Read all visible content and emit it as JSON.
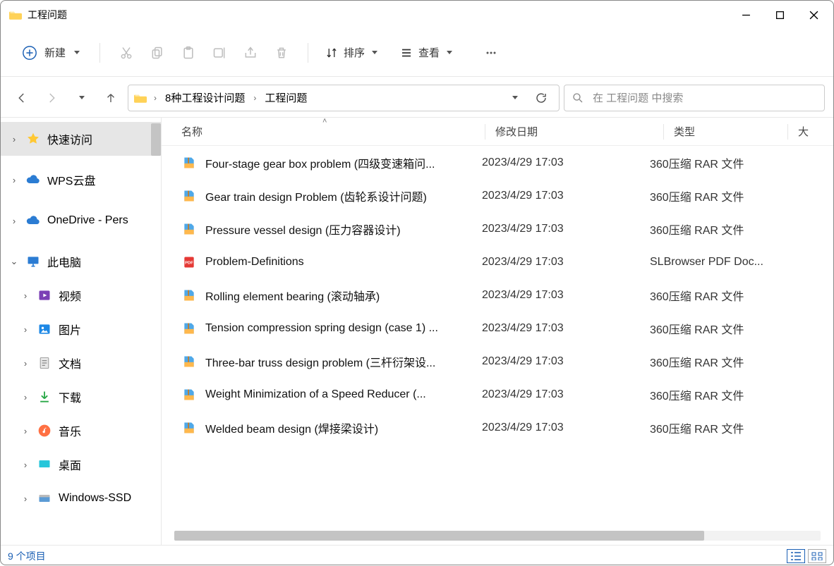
{
  "window": {
    "title": "工程问题"
  },
  "toolbar": {
    "new_label": "新建",
    "sort_label": "排序",
    "view_label": "查看"
  },
  "breadcrumb": {
    "items": [
      "8种工程设计问题",
      "工程问题"
    ]
  },
  "search": {
    "placeholder": "在 工程问题 中搜索"
  },
  "sidebar": {
    "quick": {
      "label": "快速访问",
      "selected": true
    },
    "wps": {
      "label": "WPS云盘"
    },
    "onedrive": {
      "label": "OneDrive - Pers"
    },
    "thispc": {
      "label": "此电脑",
      "expanded": true
    },
    "thispc_items": [
      {
        "label": "视频"
      },
      {
        "label": "图片"
      },
      {
        "label": "文档"
      },
      {
        "label": "下载"
      },
      {
        "label": "音乐"
      },
      {
        "label": "桌面"
      },
      {
        "label": "Windows-SSD"
      }
    ]
  },
  "columns": {
    "name": "名称",
    "date": "修改日期",
    "type": "类型",
    "size": "大"
  },
  "files": [
    {
      "name": "Four-stage gear box problem (四级变速箱问...",
      "date": "2023/4/29 17:03",
      "type": "360压缩 RAR 文件",
      "icon": "rar"
    },
    {
      "name": "Gear train design Problem (齿轮系设计问题)",
      "date": "2023/4/29 17:03",
      "type": "360压缩 RAR 文件",
      "icon": "rar"
    },
    {
      "name": "Pressure vessel design (压力容器设计)",
      "date": "2023/4/29 17:03",
      "type": "360压缩 RAR 文件",
      "icon": "rar"
    },
    {
      "name": "Problem-Definitions",
      "date": "2023/4/29 17:03",
      "type": "SLBrowser PDF Doc...",
      "icon": "pdf"
    },
    {
      "name": "Rolling element bearing (滚动轴承)",
      "date": "2023/4/29 17:03",
      "type": "360压缩 RAR 文件",
      "icon": "rar"
    },
    {
      "name": "Tension compression spring design (case 1) ...",
      "date": "2023/4/29 17:03",
      "type": "360压缩 RAR 文件",
      "icon": "rar"
    },
    {
      "name": "Three-bar truss design problem (三杆衍架设...",
      "date": "2023/4/29 17:03",
      "type": "360压缩 RAR 文件",
      "icon": "rar"
    },
    {
      "name": "Weight Minimization of a Speed Reducer  (...",
      "date": "2023/4/29 17:03",
      "type": "360压缩 RAR 文件",
      "icon": "rar"
    },
    {
      "name": "Welded beam design (焊接梁设计)",
      "date": "2023/4/29 17:03",
      "type": "360压缩 RAR 文件",
      "icon": "rar"
    }
  ],
  "status": {
    "text": "9 个项目"
  }
}
